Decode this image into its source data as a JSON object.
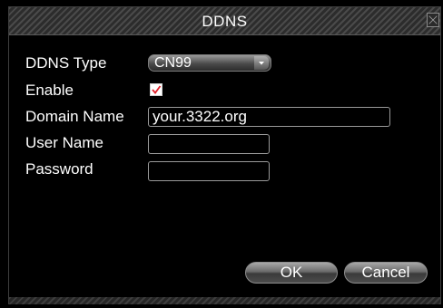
{
  "window": {
    "title": "DDNS"
  },
  "form": {
    "ddns_type": {
      "label": "DDNS Type",
      "value": "CN99"
    },
    "enable": {
      "label": "Enable",
      "checked": true
    },
    "domain_name": {
      "label": "Domain Name",
      "value": "your.3322.org"
    },
    "user_name": {
      "label": "User Name",
      "value": ""
    },
    "password": {
      "label": "Password",
      "value": ""
    }
  },
  "buttons": {
    "ok": "OK",
    "cancel": "Cancel"
  },
  "icons": {
    "close": "close-icon",
    "dropdown": "chevron-down-icon",
    "check": "checkmark-icon"
  },
  "colors": {
    "checkmark": "#e0202a",
    "background": "#000000",
    "text": "#ffffff"
  }
}
